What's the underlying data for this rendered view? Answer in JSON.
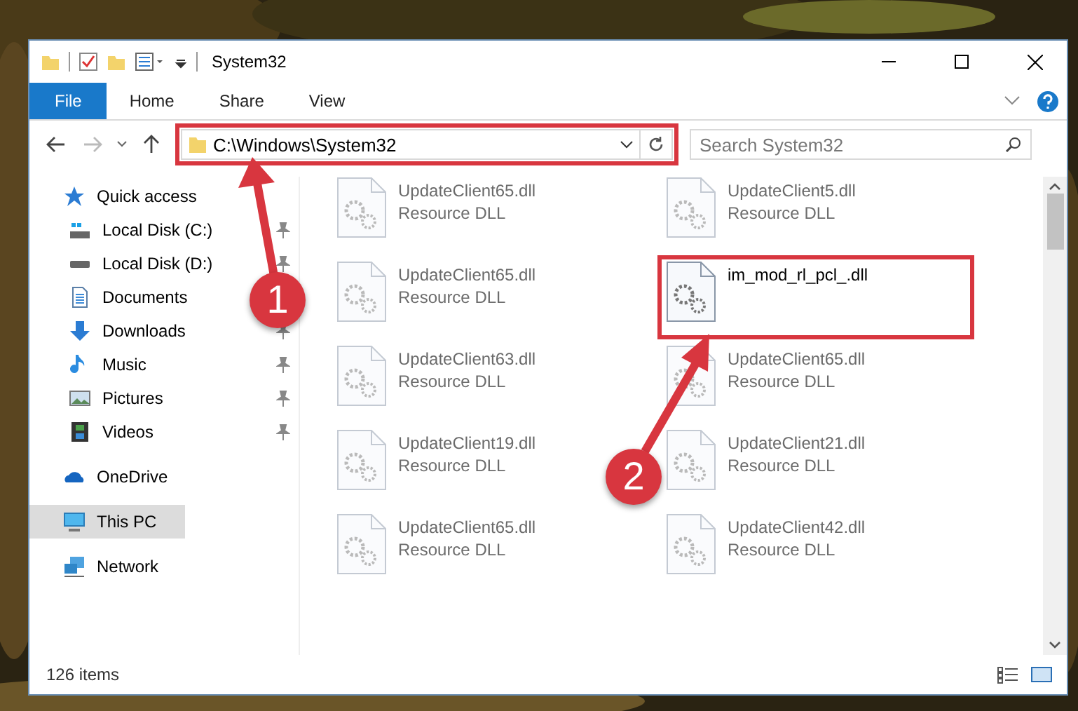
{
  "window": {
    "title": "System32"
  },
  "ribbon": {
    "tabs": [
      {
        "label": "File",
        "selected": true
      },
      {
        "label": "Home",
        "selected": false
      },
      {
        "label": "Share",
        "selected": false
      },
      {
        "label": "View",
        "selected": false
      }
    ]
  },
  "address_bar": {
    "path": "C:\\Windows\\System32",
    "outlined": true
  },
  "search": {
    "placeholder": "Search System32"
  },
  "sidebar": {
    "items": [
      {
        "kind": "quick-access",
        "label": "Quick access",
        "selected": false,
        "pinned": false,
        "children": [
          {
            "kind": "drive-c",
            "label": "Local Disk (C:)",
            "selected": false,
            "pinned": true
          },
          {
            "kind": "drive",
            "label": "Local Disk (D:)",
            "selected": false,
            "pinned": true
          },
          {
            "kind": "documents",
            "label": "Documents",
            "selected": false,
            "pinned": false
          },
          {
            "kind": "downloads",
            "label": "Downloads",
            "selected": false,
            "pinned": true
          },
          {
            "kind": "music",
            "label": "Music",
            "selected": false,
            "pinned": true
          },
          {
            "kind": "pictures",
            "label": "Pictures",
            "selected": false,
            "pinned": true
          },
          {
            "kind": "videos",
            "label": "Videos",
            "selected": false,
            "pinned": true
          }
        ]
      },
      {
        "kind": "onedrive",
        "label": "OneDrive",
        "selected": false,
        "pinned": false
      },
      {
        "kind": "pc",
        "label": "This PC",
        "selected": true,
        "pinned": false
      },
      {
        "kind": "network",
        "label": "Network",
        "selected": false,
        "pinned": false
      }
    ]
  },
  "files": [
    {
      "name": "UpdateClient65.dll",
      "type": "Resource DLL",
      "blurred": true,
      "outlined": false
    },
    {
      "name": "UpdateClient5.dll",
      "type": "Resource DLL",
      "blurred": true,
      "outlined": false
    },
    {
      "name": "UpdateClient65.dll",
      "type": "Resource DLL",
      "blurred": true,
      "outlined": false
    },
    {
      "name": "im_mod_rl_pcl_.dll",
      "blurred": false,
      "outlined": true
    },
    {
      "name": "UpdateClient63.dll",
      "type": "Resource DLL",
      "blurred": true,
      "outlined": false
    },
    {
      "name": "UpdateClient65.dll",
      "type": "Resource DLL",
      "blurred": true,
      "outlined": false
    },
    {
      "name": "UpdateClient19.dll",
      "type": "Resource DLL",
      "blurred": true,
      "outlined": false
    },
    {
      "name": "UpdateClient21.dll",
      "type": "Resource DLL",
      "blurred": true,
      "outlined": false
    },
    {
      "name": "UpdateClient65.dll",
      "type": "Resource DLL",
      "blurred": true,
      "outlined": false
    },
    {
      "name": "UpdateClient42.dll",
      "type": "Resource DLL",
      "blurred": true,
      "outlined": false
    }
  ],
  "status_bar": {
    "count": "126 items"
  },
  "annotations": [
    {
      "label": "1"
    },
    {
      "label": "2"
    }
  ]
}
